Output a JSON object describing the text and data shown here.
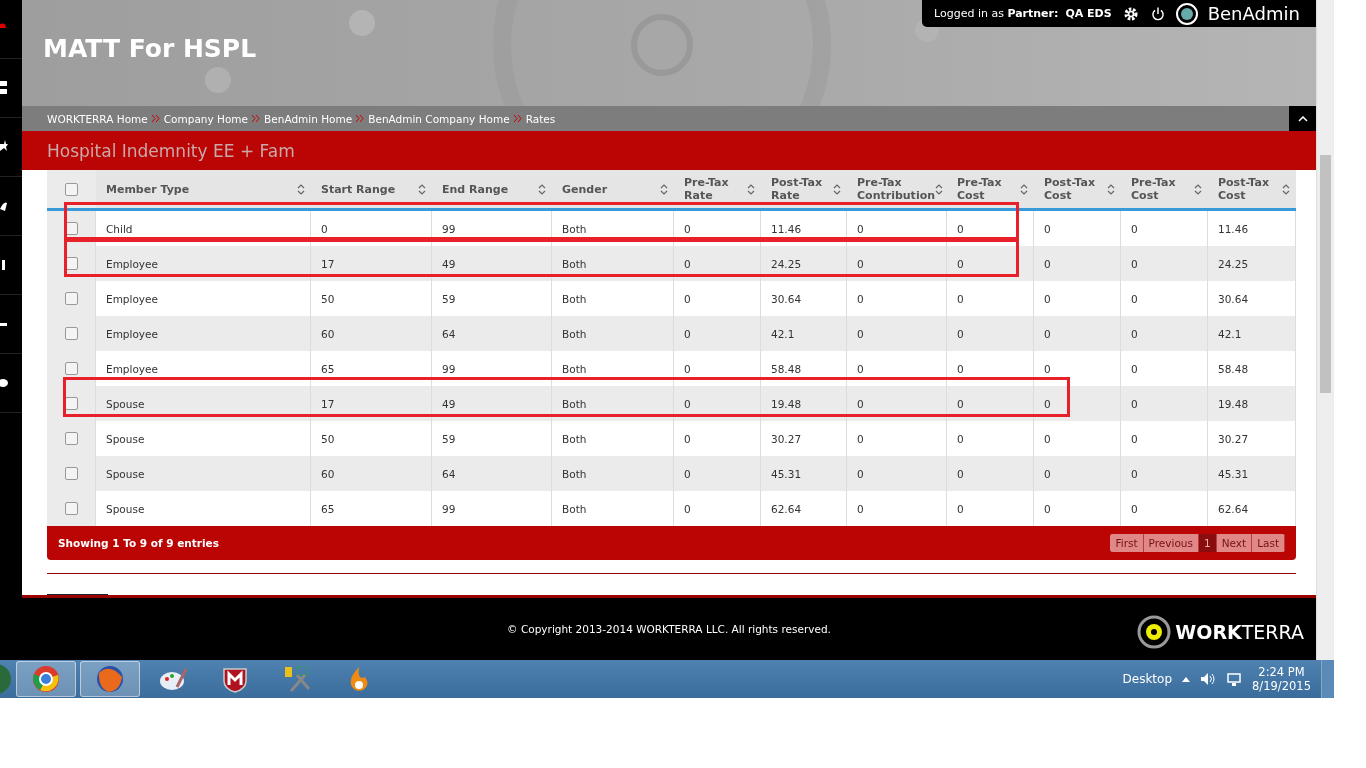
{
  "header": {
    "title": "MATT For HSPL",
    "user_prefix": "Logged in as",
    "user_role": "Partner:",
    "user_name": "QA EDS",
    "app_name": "BenAdmin"
  },
  "breadcrumbs": [
    "WORKTERRA Home",
    "Company Home",
    "BenAdmin Home",
    "BenAdmin Company Home",
    "Rates"
  ],
  "section_title": "Hospital Indemnity EE + Fam",
  "table": {
    "select_all_checked": false,
    "columns": [
      "Member Type",
      "Start Range",
      "End Range",
      "Gender",
      "Pre-Tax\nRate",
      "Post-Tax\nRate",
      "Pre-Tax\nContribution",
      "Pre-Tax\nCost",
      "Post-Tax\nCost",
      "Pre-Tax\nCost",
      "Post-Tax\nCost"
    ],
    "rows": [
      {
        "checked": false,
        "highlighted": true,
        "cells": [
          "Child",
          "0",
          "99",
          "Both",
          "0",
          "11.46",
          "0",
          "0",
          "0",
          "0",
          "11.46"
        ]
      },
      {
        "checked": false,
        "highlighted": true,
        "cells": [
          "Employee",
          "17",
          "49",
          "Both",
          "0",
          "24.25",
          "0",
          "0",
          "0",
          "0",
          "24.25"
        ]
      },
      {
        "checked": false,
        "highlighted": false,
        "cells": [
          "Employee",
          "50",
          "59",
          "Both",
          "0",
          "30.64",
          "0",
          "0",
          "0",
          "0",
          "30.64"
        ]
      },
      {
        "checked": false,
        "highlighted": false,
        "cells": [
          "Employee",
          "60",
          "64",
          "Both",
          "0",
          "42.1",
          "0",
          "0",
          "0",
          "0",
          "42.1"
        ]
      },
      {
        "checked": false,
        "highlighted": false,
        "cells": [
          "Employee",
          "65",
          "99",
          "Both",
          "0",
          "58.48",
          "0",
          "0",
          "0",
          "0",
          "58.48"
        ]
      },
      {
        "checked": false,
        "highlighted": true,
        "cells": [
          "Spouse",
          "17",
          "49",
          "Both",
          "0",
          "19.48",
          "0",
          "0",
          "0",
          "0",
          "19.48"
        ]
      },
      {
        "checked": false,
        "highlighted": false,
        "cells": [
          "Spouse",
          "50",
          "59",
          "Both",
          "0",
          "30.27",
          "0",
          "0",
          "0",
          "0",
          "30.27"
        ]
      },
      {
        "checked": false,
        "highlighted": false,
        "cells": [
          "Spouse",
          "60",
          "64",
          "Both",
          "0",
          "45.31",
          "0",
          "0",
          "0",
          "0",
          "45.31"
        ]
      },
      {
        "checked": false,
        "highlighted": false,
        "cells": [
          "Spouse",
          "65",
          "99",
          "Both",
          "0",
          "62.64",
          "0",
          "0",
          "0",
          "0",
          "62.64"
        ]
      }
    ],
    "info": "Showing 1 To 9 of 9 entries",
    "pagination": [
      {
        "label": "First",
        "selected": false
      },
      {
        "label": "Previous",
        "selected": false
      },
      {
        "label": "1",
        "selected": true
      },
      {
        "label": "Next",
        "selected": false
      },
      {
        "label": "Last",
        "selected": false
      }
    ]
  },
  "footer": {
    "copyright": "© Copyright 2013-2014 WORKTERRA LLC. All rights reserved.",
    "logo_bold": "WORK",
    "logo_light": "TERRA"
  },
  "taskbar": {
    "desktop": "Desktop",
    "time": "2:24 PM",
    "date": "8/19/2015"
  }
}
